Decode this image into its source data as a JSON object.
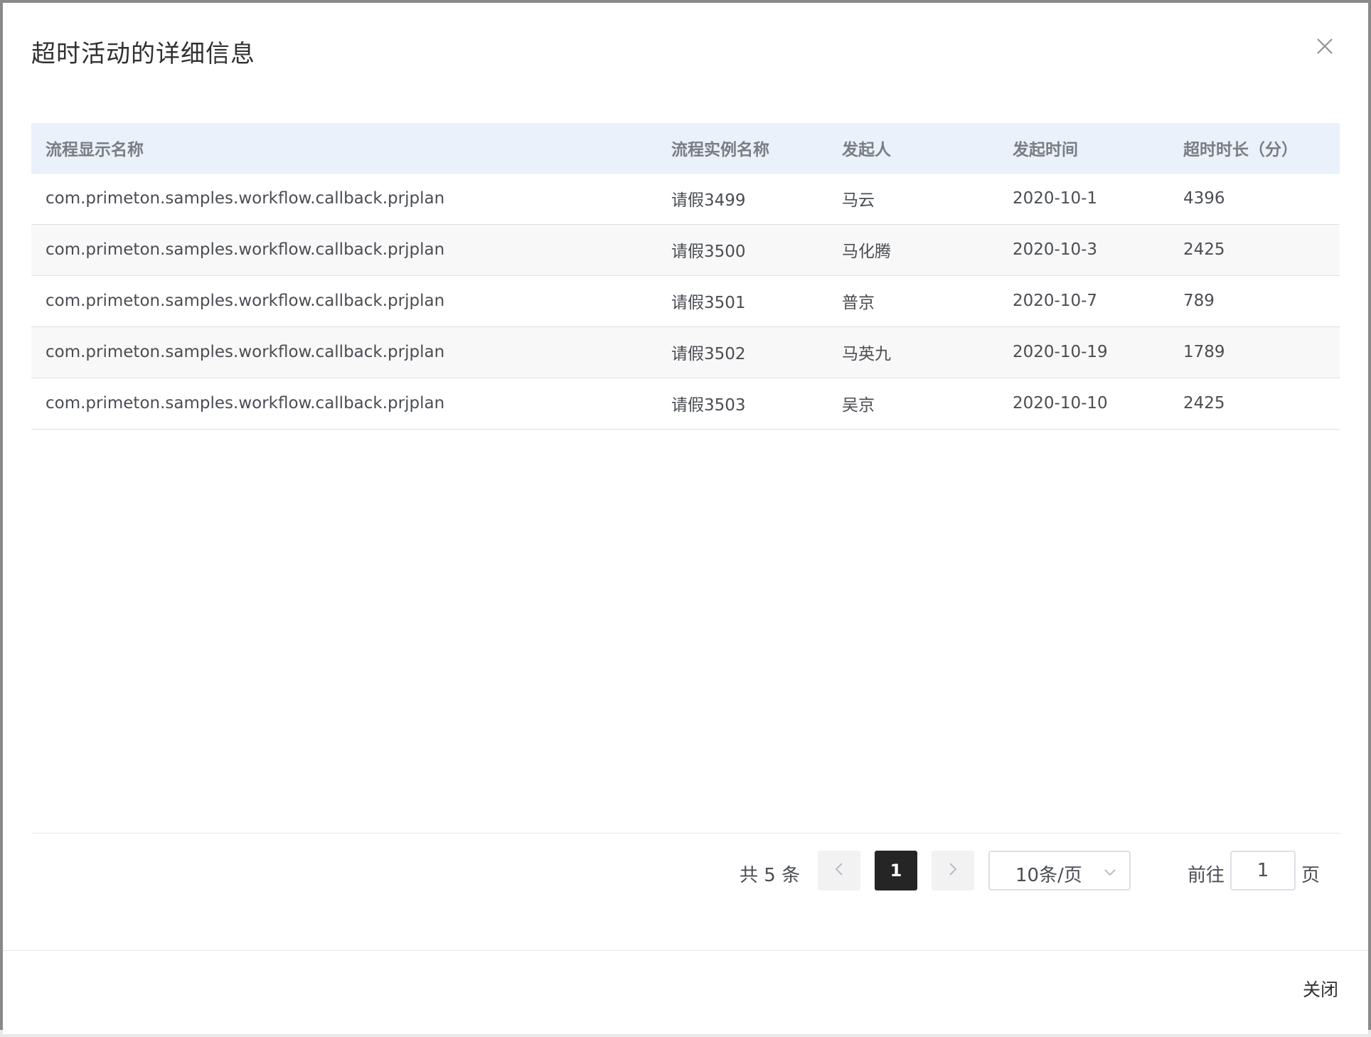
{
  "dialog": {
    "title": "超时活动的详细信息",
    "close_icon": "close-icon"
  },
  "table": {
    "headers": [
      "流程显示名称",
      "流程实例名称",
      "发起人",
      "发起时间",
      "超时时长（分）"
    ],
    "rows": [
      [
        "com.primeton.samples.workflow.callback.prjplan",
        "请假3499",
        "马云",
        "2020-10-1",
        "4396"
      ],
      [
        "com.primeton.samples.workflow.callback.prjplan",
        "请假3500",
        "马化腾",
        "2020-10-3",
        "2425"
      ],
      [
        "com.primeton.samples.workflow.callback.prjplan",
        "请假3501",
        "普京",
        "2020-10-7",
        "789"
      ],
      [
        "com.primeton.samples.workflow.callback.prjplan",
        "请假3502",
        "马英九",
        "2020-10-19",
        "1789"
      ],
      [
        "com.primeton.samples.workflow.callback.prjplan",
        "请假3503",
        "吴京",
        "2020-10-10",
        "2425"
      ]
    ]
  },
  "pagination": {
    "total_label": "共 5 条",
    "current_page": "1",
    "page_size": "10条/页",
    "goto_prefix": "前往",
    "goto_value": "1",
    "goto_suffix": "页"
  },
  "footer": {
    "close_label": "关闭"
  },
  "colors": {
    "header_bg": "#eaf1fb",
    "active_page_bg": "#252525",
    "stripe_bg": "#f8f8f8"
  }
}
